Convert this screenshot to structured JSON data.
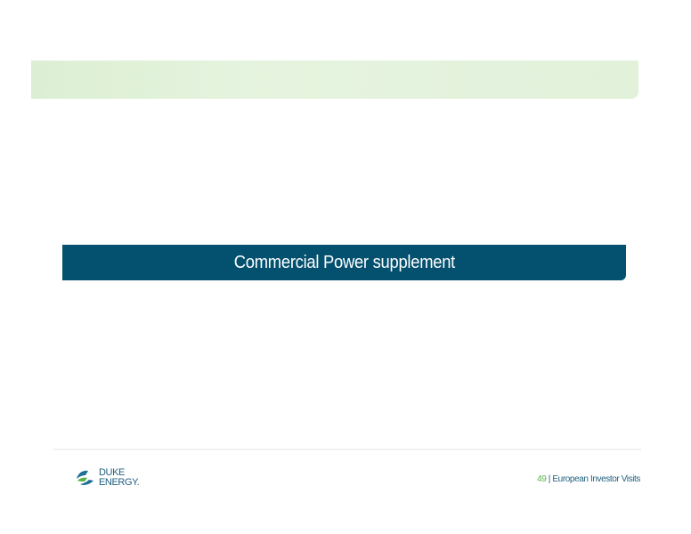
{
  "slide": {
    "section_title": "Commercial Power supplement"
  },
  "footer": {
    "logo": {
      "line1": "DUKE",
      "line2": "ENERGY."
    },
    "page_number": "49",
    "separator": "|",
    "caption": "European Investor Visits"
  },
  "colors": {
    "header_band": "#e1f1da",
    "section_bar": "#03506f",
    "accent_green": "#5ab248",
    "text_blue": "#1f5f7e"
  },
  "icons": {
    "logo": "duke-energy-logo-icon"
  }
}
